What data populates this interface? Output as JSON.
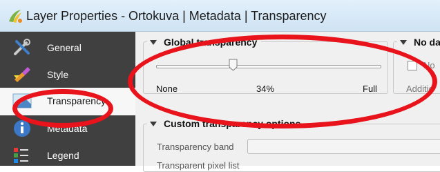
{
  "window": {
    "title": "Layer Properties - Ortokuva | Metadata | Transparency"
  },
  "sidebar": {
    "items": [
      {
        "label": "General",
        "icon": "wrench-screwdriver-icon",
        "active": false
      },
      {
        "label": "Style",
        "icon": "paintbrush-icon",
        "active": false
      },
      {
        "label": "Transparency",
        "icon": "raster-transparency-icon",
        "active": true
      },
      {
        "label": "Metadata",
        "icon": "info-icon",
        "active": false
      },
      {
        "label": "Legend",
        "icon": "legend-icon",
        "active": false
      }
    ]
  },
  "global_transparency": {
    "title": "Global transparency",
    "slider_value_percent": 34,
    "min_label": "None",
    "value_label": "34%",
    "max_label": "Full"
  },
  "no_data": {
    "title": "No da",
    "checkbox_label": "No",
    "additional_label": "Additio"
  },
  "custom_transparency": {
    "title": "Custom transparency options",
    "band_label": "Transparency band",
    "band_value": "",
    "pixel_list_label": "Transparent pixel list"
  },
  "colors": {
    "annotation_red": "#e8131b",
    "sidebar_bg": "#404040",
    "titlebar_bg": "#d8e9f7"
  }
}
